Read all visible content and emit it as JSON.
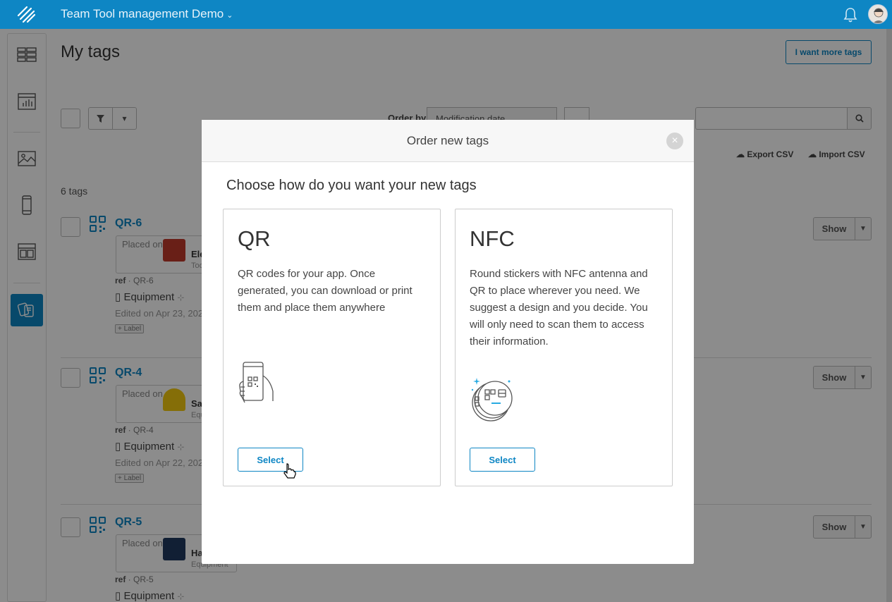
{
  "header": {
    "app_title": "Team Tool management Demo",
    "accent_color": "#0e86c4"
  },
  "sidebar": {
    "items": [
      {
        "icon": "dashboard-grid-icon"
      },
      {
        "icon": "bar-chart-icon"
      },
      {
        "icon": "image-gallery-icon"
      },
      {
        "icon": "mobile-device-icon"
      },
      {
        "icon": "layout-template-icon"
      },
      {
        "icon": "tags-icon",
        "active": true
      }
    ]
  },
  "page": {
    "title": "My tags",
    "more_tags_button": "I want more tags",
    "order_by_label": "Order by",
    "order_by_value": "Modification date",
    "export_csv": "Export CSV",
    "import_csv": "Import CSV",
    "tag_count": "6 tags"
  },
  "tags": [
    {
      "name": "QR-6",
      "placed_label": "Placed on",
      "item_name": "Ele",
      "item_type": "Too",
      "ref_label": "ref",
      "ref": "QR-6",
      "category": "Equipment",
      "edited": "Edited on Apr 23, 202",
      "label_chip": "+ Label",
      "show": "Show"
    },
    {
      "name": "QR-4",
      "placed_label": "Placed on",
      "item_name": "Sa",
      "item_type": "Equ",
      "ref_label": "ref",
      "ref": "QR-4",
      "category": "Equipment",
      "edited": "Edited on Apr 22, 202",
      "label_chip": "+ Label",
      "show": "Show"
    },
    {
      "name": "QR-5",
      "placed_label": "Placed on",
      "item_name": "Ha",
      "item_type": "Equipment",
      "ref_label": "ref",
      "ref": "QR-5",
      "category": "Equipment",
      "show": "Show"
    }
  ],
  "modal": {
    "title": "Order new tags",
    "close_symbol": "×",
    "subtitle": "Choose how do you want your new tags",
    "options": [
      {
        "title": "QR",
        "description": "QR codes for your app. Once generated, you can download or print them and place them anywhere",
        "illustration": "hand-phone-qr-icon",
        "select_label": "Select"
      },
      {
        "title": "NFC",
        "description": "Round stickers with NFC antenna and QR to place wherever you need. We suggest a design and you decide. You will only need to scan them to access their information.",
        "illustration": "nfc-stickers-icon",
        "select_label": "Select"
      }
    ]
  }
}
